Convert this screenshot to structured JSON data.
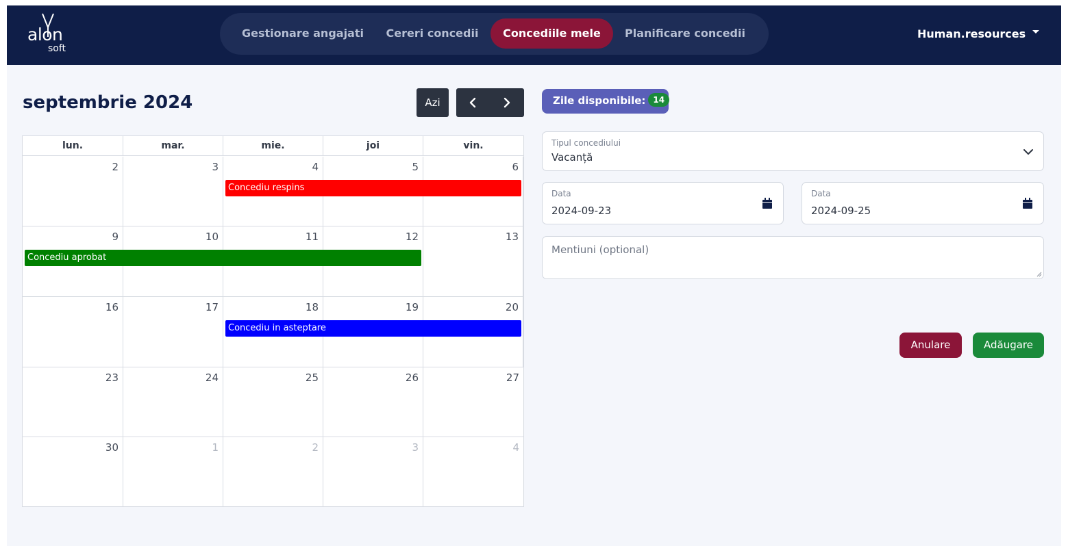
{
  "brand": {
    "logo_main": "alon",
    "logo_sub": "soft"
  },
  "nav": {
    "items": [
      {
        "label": "Gestionare angajati",
        "active": false
      },
      {
        "label": "Cereri concedii",
        "active": false
      },
      {
        "label": "Concediile mele",
        "active": true
      },
      {
        "label": "Planificare concedii",
        "active": false
      }
    ],
    "user": "Human.resources"
  },
  "calendar": {
    "title": "septembrie 2024",
    "today_label": "Azi",
    "weekdays": [
      "lun.",
      "mar.",
      "mie.",
      "joi",
      "vin."
    ],
    "weeks": [
      {
        "days": [
          {
            "num": "2",
            "other": false
          },
          {
            "num": "3",
            "other": false
          },
          {
            "num": "4",
            "other": false
          },
          {
            "num": "5",
            "other": false
          },
          {
            "num": "6",
            "other": false
          }
        ]
      },
      {
        "days": [
          {
            "num": "9",
            "other": false
          },
          {
            "num": "10",
            "other": false
          },
          {
            "num": "11",
            "other": false
          },
          {
            "num": "12",
            "other": false
          },
          {
            "num": "13",
            "other": false
          }
        ]
      },
      {
        "days": [
          {
            "num": "16",
            "other": false
          },
          {
            "num": "17",
            "other": false
          },
          {
            "num": "18",
            "other": false
          },
          {
            "num": "19",
            "other": false
          },
          {
            "num": "20",
            "other": false
          }
        ]
      },
      {
        "days": [
          {
            "num": "23",
            "other": false
          },
          {
            "num": "24",
            "other": false
          },
          {
            "num": "25",
            "other": false
          },
          {
            "num": "26",
            "other": false
          },
          {
            "num": "27",
            "other": false
          }
        ]
      },
      {
        "days": [
          {
            "num": "30",
            "other": false
          },
          {
            "num": "1",
            "other": true
          },
          {
            "num": "2",
            "other": true
          },
          {
            "num": "3",
            "other": true
          },
          {
            "num": "4",
            "other": true
          }
        ]
      }
    ],
    "events": [
      {
        "label": "Concediu respins",
        "status": "respins",
        "color": "#ff0000",
        "start": "2024-09-04",
        "end": "2024-09-06"
      },
      {
        "label": "Concediu aprobat",
        "status": "aprobat",
        "color": "#008000",
        "start": "2024-09-09",
        "end": "2024-09-12"
      },
      {
        "label": "Concediu in asteptare",
        "status": "asteptare",
        "color": "#0000ff",
        "start": "2024-09-18",
        "end": "2024-09-20"
      }
    ]
  },
  "form": {
    "available_label": "Zile disponibile:",
    "available_count": "14",
    "leave_type": {
      "label": "Tipul concediului",
      "value": "Vacanță"
    },
    "date_from": {
      "label": "Data",
      "value": "2024-09-23"
    },
    "date_to": {
      "label": "Data",
      "value": "2024-09-25"
    },
    "notes": {
      "placeholder": "Mentiuni (optional)"
    },
    "cancel_label": "Anulare",
    "add_label": "Adăugare"
  },
  "colors": {
    "navbar": "#0f1e48",
    "active_tab": "#8b1538",
    "badge": "#5a5fb8",
    "success": "#1a8a3a"
  }
}
